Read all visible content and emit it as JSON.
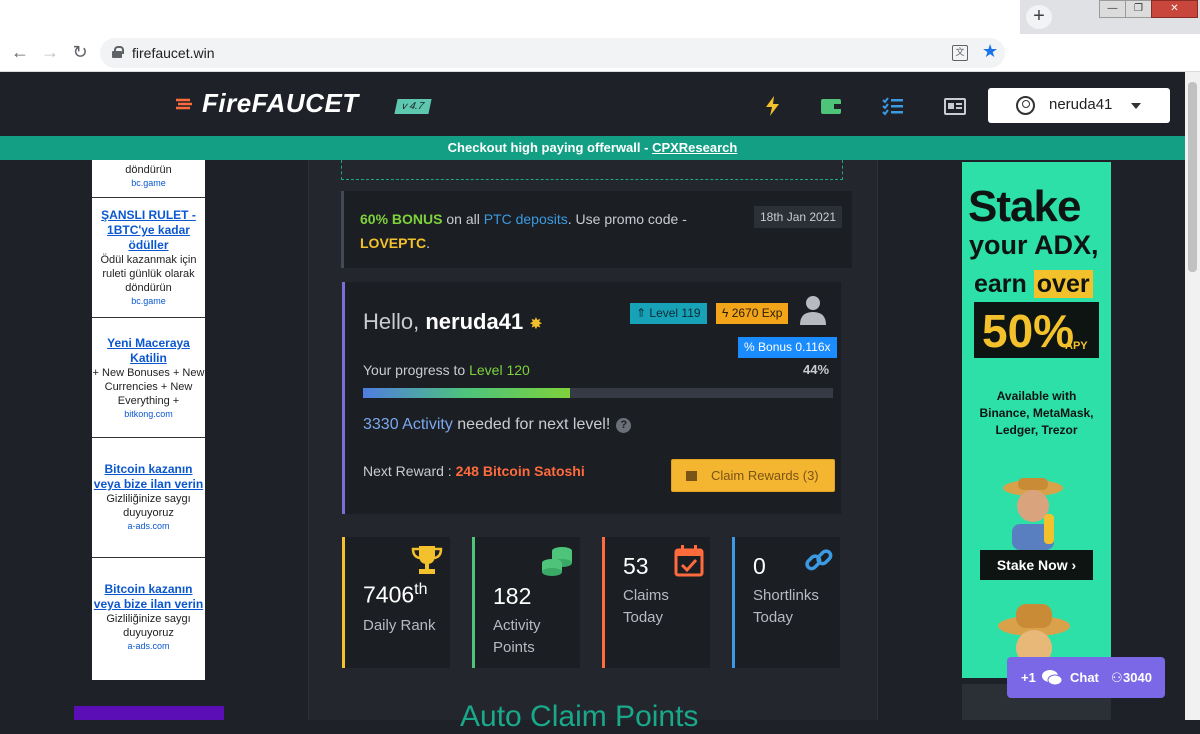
{
  "browser": {
    "url": "firefaucet.win",
    "new_tab_label": "+",
    "window_controls": {
      "minimize": "—",
      "restore": "❐",
      "close": "✕"
    }
  },
  "header": {
    "logo_text": "FireFAUCET",
    "version": "v 4.7",
    "username": "neruda41"
  },
  "banner": {
    "text": "Checkout high paying offerwall - ",
    "link": "CPXResearch"
  },
  "left_ads": [
    {
      "title": "",
      "body": "döndürün",
      "domain": "bc.game"
    },
    {
      "title": "ŞANSLI RULET - 1BTC'ye kadar ödüller",
      "body": "Ödül kazanmak için ruleti günlük olarak döndürün",
      "domain": "bc.game"
    },
    {
      "title": "Yeni Maceraya Katilin",
      "body": "+ New Bonuses + New Currencies + New Everything +",
      "domain": "bitkong.com"
    },
    {
      "title": "Bitcoin kazanın veya bize ilan verin",
      "body": "Gizliliğinize saygı duyuyoruz",
      "domain": "a-ads.com"
    },
    {
      "title": "Bitcoin kazanın veya bize ilan verin",
      "body": "Gizliliğinize saygı duyuyoruz",
      "domain": "a-ads.com"
    }
  ],
  "promo": {
    "pct": "60% BONUS",
    "text1": " on all ",
    "link": "PTC deposits",
    "text2": ". Use promo code - ",
    "code": "LOVEPTC",
    "end": ".",
    "date": "18th Jan 2021"
  },
  "profile": {
    "hello": "Hello, ",
    "username": "neruda41",
    "level_badge": "Level 119",
    "exp_badge": "2670 Exp",
    "bonus_badge": "Bonus 0.116x",
    "progress_label": "Your progress to ",
    "next_level": "Level 120",
    "progress_pct_text": "44%",
    "progress_value": 0.44,
    "activity_needed": "3330 Activity",
    "activity_suffix": " needed for next level!",
    "reward_label": "Next Reward : ",
    "reward_value": "248 Bitcoin Satoshi",
    "claim_button": "Claim Rewards (3)"
  },
  "stats": [
    {
      "value": "7406",
      "sup": "th",
      "label1": "Daily Rank",
      "label2": "",
      "accent": "#f3c12b",
      "icon": "trophy-icon"
    },
    {
      "value": "182",
      "sup": "",
      "label1": "Activity",
      "label2": "Points",
      "accent": "#4ec47b",
      "icon": "coins-icon"
    },
    {
      "value": "53",
      "sup": "",
      "label1": "Claims",
      "label2": "Today",
      "accent": "#ff6b3d",
      "icon": "calendar-check-icon"
    },
    {
      "value": "0",
      "sup": "",
      "label1": "Shortlinks",
      "label2": "Today",
      "accent": "#3b9ae1",
      "icon": "link-icon"
    }
  ],
  "section_heading": "Auto Claim Points",
  "right_ad": {
    "line1": "Stake",
    "line2": "your ADX,",
    "line3a": "earn ",
    "line3b": "over",
    "big": "50%",
    "apy": "APY",
    "avail1": "Available with",
    "avail2": "Binance, MetaMask,",
    "avail3": "Ledger, Trezor",
    "button": "Stake Now ›"
  },
  "chat": {
    "plus": "+1",
    "label": "Chat",
    "count": "3040"
  },
  "colors": {
    "teal": "#129f84",
    "accent_green": "#7ed23c",
    "accent_yellow": "#f3c12b",
    "accent_blue": "#3b9ae1",
    "chat_purple": "#7b68e6"
  }
}
